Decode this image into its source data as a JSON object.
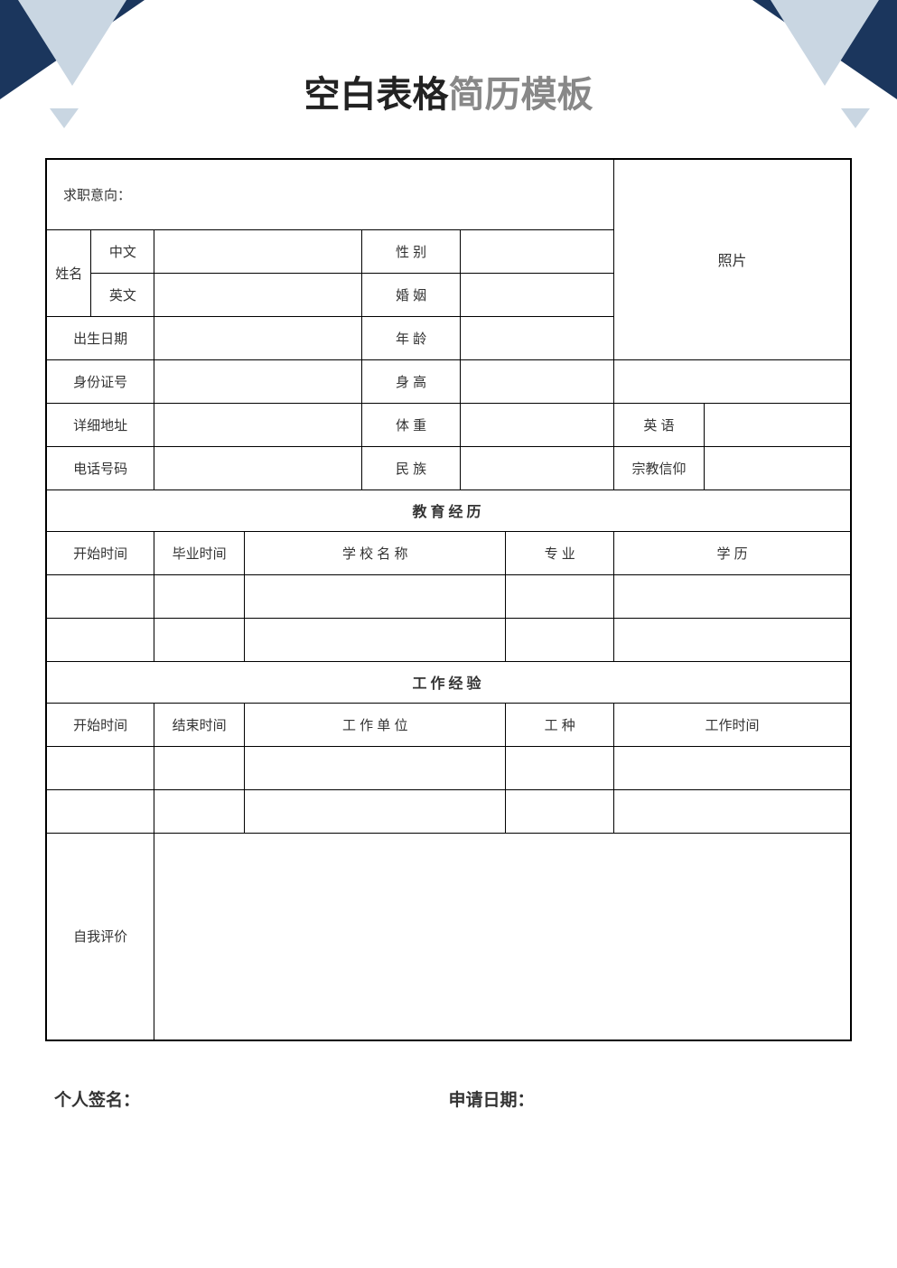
{
  "title": {
    "dark": "空白表格",
    "light": "简历模板"
  },
  "labels": {
    "job_intent": "求职意向：",
    "name": "姓名",
    "name_cn": "中文",
    "name_en": "英文",
    "gender": "性 别",
    "marriage": "婚 姻",
    "birth": "出生日期",
    "age": "年 龄",
    "id_no": "身份证号",
    "height": "身 高",
    "address": "详细地址",
    "weight": "体 重",
    "english": "英 语",
    "phone": "电话号码",
    "ethnicity": "民 族",
    "religion": "宗教信仰",
    "photo": "照片",
    "edu_section": "教育经历",
    "edu_start": "开始时间",
    "edu_end": "毕业时间",
    "edu_school": "学 校 名 称",
    "edu_major": "专 业",
    "edu_degree": "学 历",
    "work_section": "工作经验",
    "work_start": "开始时间",
    "work_end": "结束时间",
    "work_unit": "工 作 单 位",
    "work_type": "工 种",
    "work_duration": "工作时间",
    "self_eval": "自我评价"
  },
  "values": {
    "job_intent": "",
    "name_cn": "",
    "name_en": "",
    "gender": "",
    "marriage": "",
    "birth": "",
    "age": "",
    "id_no": "",
    "height": "",
    "address": "",
    "weight": "",
    "english": "",
    "phone": "",
    "ethnicity": "",
    "religion": "",
    "edu_rows": [
      {
        "start": "",
        "end": "",
        "school": "",
        "major": "",
        "degree": ""
      },
      {
        "start": "",
        "end": "",
        "school": "",
        "major": "",
        "degree": ""
      }
    ],
    "work_rows": [
      {
        "start": "",
        "end": "",
        "unit": "",
        "type": "",
        "duration": ""
      },
      {
        "start": "",
        "end": "",
        "unit": "",
        "type": "",
        "duration": ""
      }
    ],
    "self_eval": ""
  },
  "footer": {
    "signature_label": "个人签名：",
    "date_label": "申请日期："
  }
}
